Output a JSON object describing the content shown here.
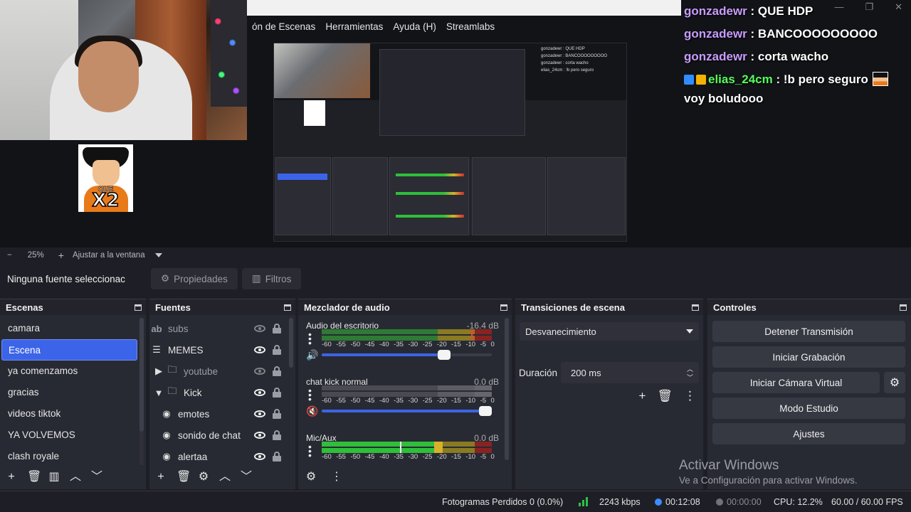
{
  "preview": {
    "menu": [
      "ón de Escenas",
      "Herramientas",
      "Ayuda (H)",
      "Streamlabs"
    ],
    "goku_text": "X2",
    "goku_small": "QUE",
    "chat": [
      {
        "user": "gonzadewr",
        "text": ": QUE HDP"
      },
      {
        "user": "gonzadewr",
        "text": ": BANCOOOOOOOOO"
      },
      {
        "user": "gonzadewr",
        "text": ": corta wacho"
      },
      {
        "user": "elias_24cm",
        "text": ": !b pero seguro",
        "continuation": "voy boludooo"
      }
    ],
    "window_controls": [
      "—",
      "❐",
      "✕"
    ]
  },
  "zoom": {
    "minus": "−",
    "value": "25%",
    "plus": "+",
    "fit": "Ajustar a la ventana"
  },
  "source_toolbar": {
    "no_selection": "Ninguna fuente seleccionac",
    "properties": "Propiedades",
    "filters": "Filtros"
  },
  "scenes": {
    "title": "Escenas",
    "items": [
      "camara",
      "Escena",
      "ya comenzamos",
      "gracias",
      "videos tiktok",
      "YA VOLVEMOS",
      "clash royale"
    ],
    "active_index": 1
  },
  "sources": {
    "title": "Fuentes",
    "items": [
      {
        "label": "subs",
        "icon": "ab",
        "visible": false
      },
      {
        "label": "MEMES",
        "icon": "☰",
        "visible": true
      },
      {
        "label": "youtube",
        "icon": "folder",
        "visible": false,
        "collapsed": true
      },
      {
        "label": "Kick",
        "icon": "folder",
        "visible": true,
        "expanded": true
      },
      {
        "label": "emotes",
        "icon": "globe",
        "visible": true
      },
      {
        "label": "sonido de chat",
        "icon": "globe",
        "visible": true
      },
      {
        "label": "alertaa",
        "icon": "globe",
        "visible": true
      }
    ]
  },
  "mixer": {
    "title": "Mezclador de audio",
    "channels": [
      {
        "name": "Audio del escritorio",
        "db": "-16.4 dB",
        "level": 0.72,
        "muted": false
      },
      {
        "name": "chat kick normal",
        "db": "0.0 dB",
        "level": 1.0,
        "muted": true
      },
      {
        "name": "Mic/Aux",
        "db": "0.0 dB",
        "level": 1.0,
        "muted": false
      }
    ],
    "ticks": [
      "-60",
      "-55",
      "-50",
      "-45",
      "-40",
      "-35",
      "-30",
      "-25",
      "-20",
      "-15",
      "-10",
      "-5",
      "0"
    ]
  },
  "transitions": {
    "title": "Transiciones de escena",
    "selected": "Desvanecimiento",
    "duration_label": "Duración",
    "duration_value": "200 ms"
  },
  "controls": {
    "title": "Controles",
    "stop_stream": "Detener Transmisión",
    "start_recording": "Iniciar Grabación",
    "start_virtual_cam": "Iniciar Cámara Virtual",
    "studio_mode": "Modo Estudio",
    "settings": "Ajustes"
  },
  "watermark": {
    "line1": "Activar Windows",
    "line2": "Ve a Configuración para activar Windows."
  },
  "status": {
    "dropped": "Fotogramas Perdidos 0 (0.0%)",
    "bitrate": "2243 kbps",
    "stream_time": "00:12:08",
    "rec_time": "00:00:00",
    "cpu": "CPU: 12.2%",
    "fps": "60.00 / 60.00 FPS"
  },
  "colors": {
    "accent": "#3c64e8",
    "bg": "#1e1f26",
    "dock": "#282a33"
  }
}
